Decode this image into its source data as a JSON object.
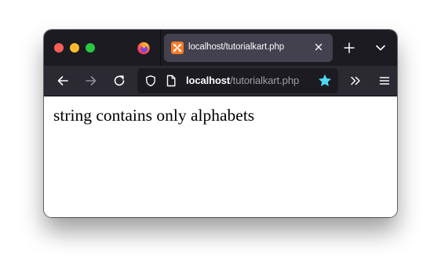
{
  "tab": {
    "title": "localhost/tutorialkart.php"
  },
  "urlbar": {
    "host": "localhost",
    "path": "/tutorialkart.php"
  },
  "page": {
    "body_text": "string contains only alphabets"
  },
  "colors": {
    "tab_bar": "#1c1b22",
    "toolbar": "#2b2a33",
    "selected_tab": "#42414d",
    "star_accent": "#54ffbd",
    "favicon": "#fb7a24"
  },
  "icons": {
    "window_controls": [
      "close-dot",
      "minimize-dot",
      "maximize-dot"
    ],
    "browser_logo": "firefox-icon",
    "favicon": "xampp-icon",
    "tab_close": "close-icon",
    "new_tab": "plus-icon",
    "tab_list": "chevron-down-icon",
    "back": "arrow-left-icon",
    "forward": "arrow-right-icon",
    "reload": "reload-icon",
    "tracking_protection": "shield-icon",
    "page_info": "page-icon",
    "bookmark": "star-icon",
    "overflow": "double-chevron-icon",
    "menu": "hamburger-icon"
  }
}
